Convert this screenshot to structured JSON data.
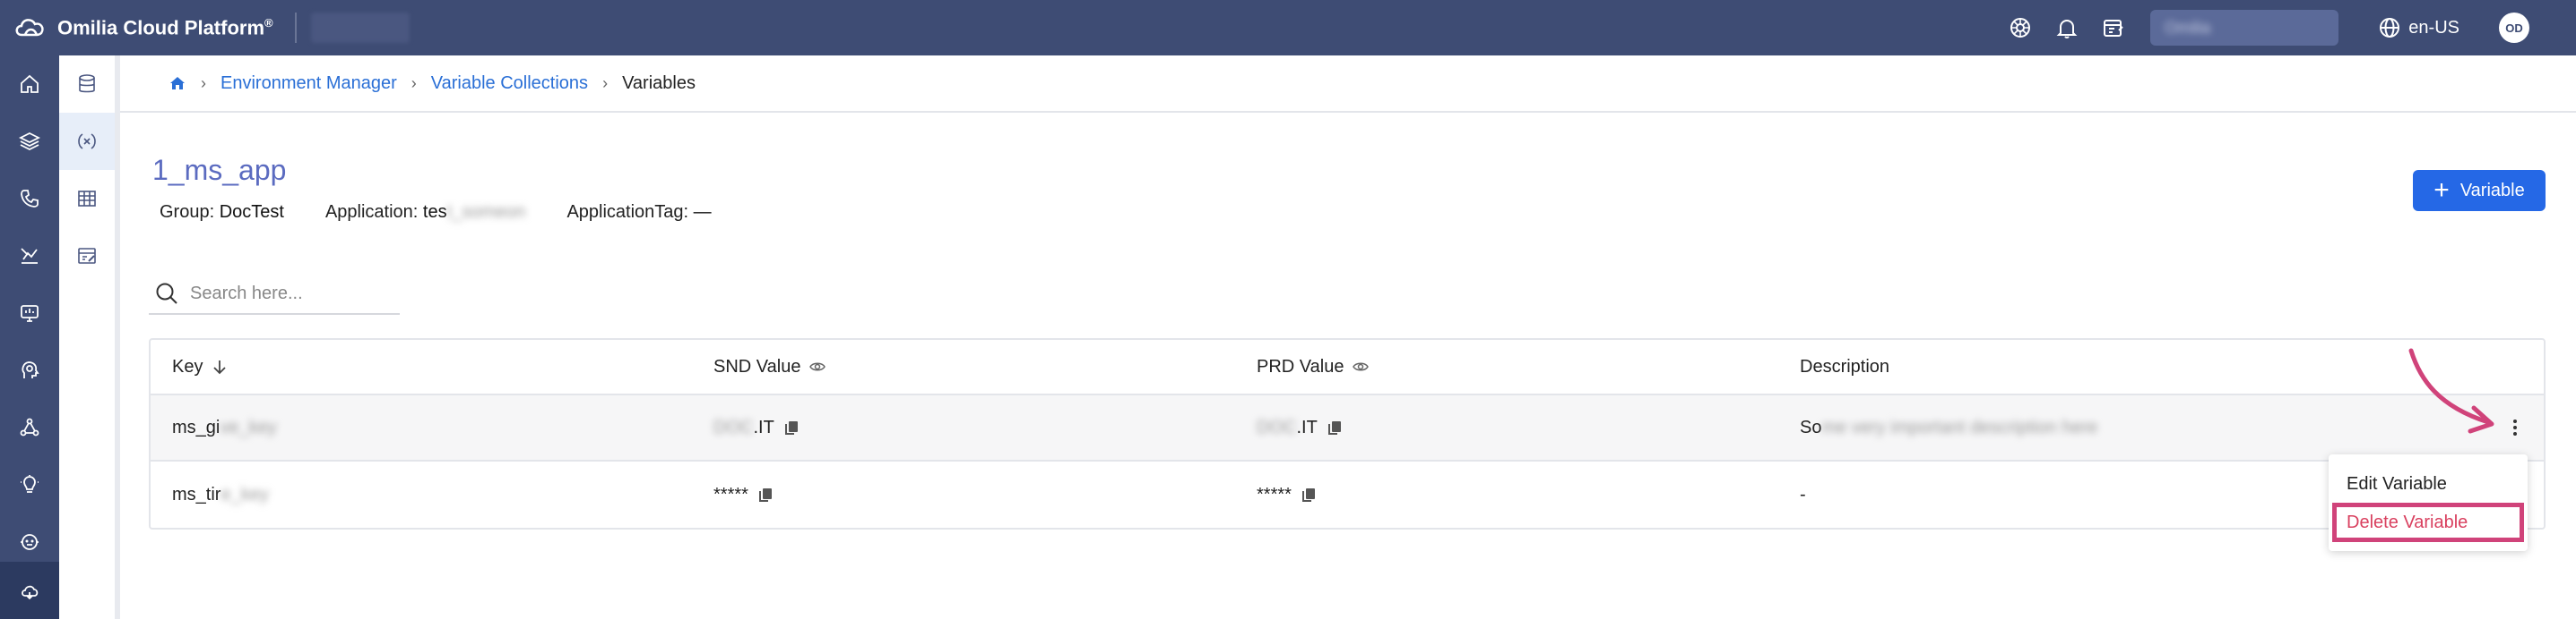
{
  "app": {
    "title": "Omilia Cloud Platform",
    "title_mark": "®",
    "org_placeholder": "Omilia",
    "language": "en-US",
    "avatar_initials": "OD",
    "brand_color": "#3e4c74",
    "accent_color": "#2568e6"
  },
  "topbar": {
    "icons": [
      "settings-sun-icon",
      "bell-icon",
      "notes-icon"
    ]
  },
  "leftnav": {
    "icons": [
      "home-icon",
      "layers-icon",
      "phone-icon",
      "analytics-icon",
      "monitor-icon",
      "head-gear-icon",
      "nodes-icon",
      "lightbulb-icon",
      "robot-icon",
      "cloud-icon"
    ]
  },
  "subnav": {
    "icons": [
      "database-icon",
      "variables-icon",
      "table-icon",
      "form-edit-icon"
    ]
  },
  "breadcrumb": {
    "items": [
      {
        "label": "Environment Manager"
      },
      {
        "label": "Variable Collections"
      },
      {
        "label": "Variables"
      }
    ]
  },
  "page": {
    "title": "1_ms_app",
    "group_label": "Group: ",
    "group_value": "DocTest",
    "application_label": "Application: ",
    "application_value": "tes",
    "application_blurred": "t_someon",
    "application_tag_label": "ApplicationTag: ",
    "application_tag_value": "—",
    "add_button_label": "Variable"
  },
  "search": {
    "placeholder": "Search here..."
  },
  "table": {
    "headers": {
      "key": "Key",
      "snd": "SND Value",
      "prd": "PRD Value",
      "description": "Description"
    },
    "rows": [
      {
        "key_visible": "ms_gi",
        "key_blurred": "ve_key",
        "snd_blurred": "DOC",
        "snd_visible": ".IT",
        "prd_blurred": "DOC",
        "prd_visible": ".IT",
        "desc_visible": "So",
        "desc_blurred": "me very important description here"
      },
      {
        "key_visible": "ms_tir",
        "key_blurred": "e_key",
        "snd_visible": "*****",
        "prd_visible": "*****",
        "desc_visible": "-"
      }
    ]
  },
  "menu": {
    "edit_label": "Edit Variable",
    "delete_label": "Delete Variable",
    "danger_color": "#d9405f"
  }
}
